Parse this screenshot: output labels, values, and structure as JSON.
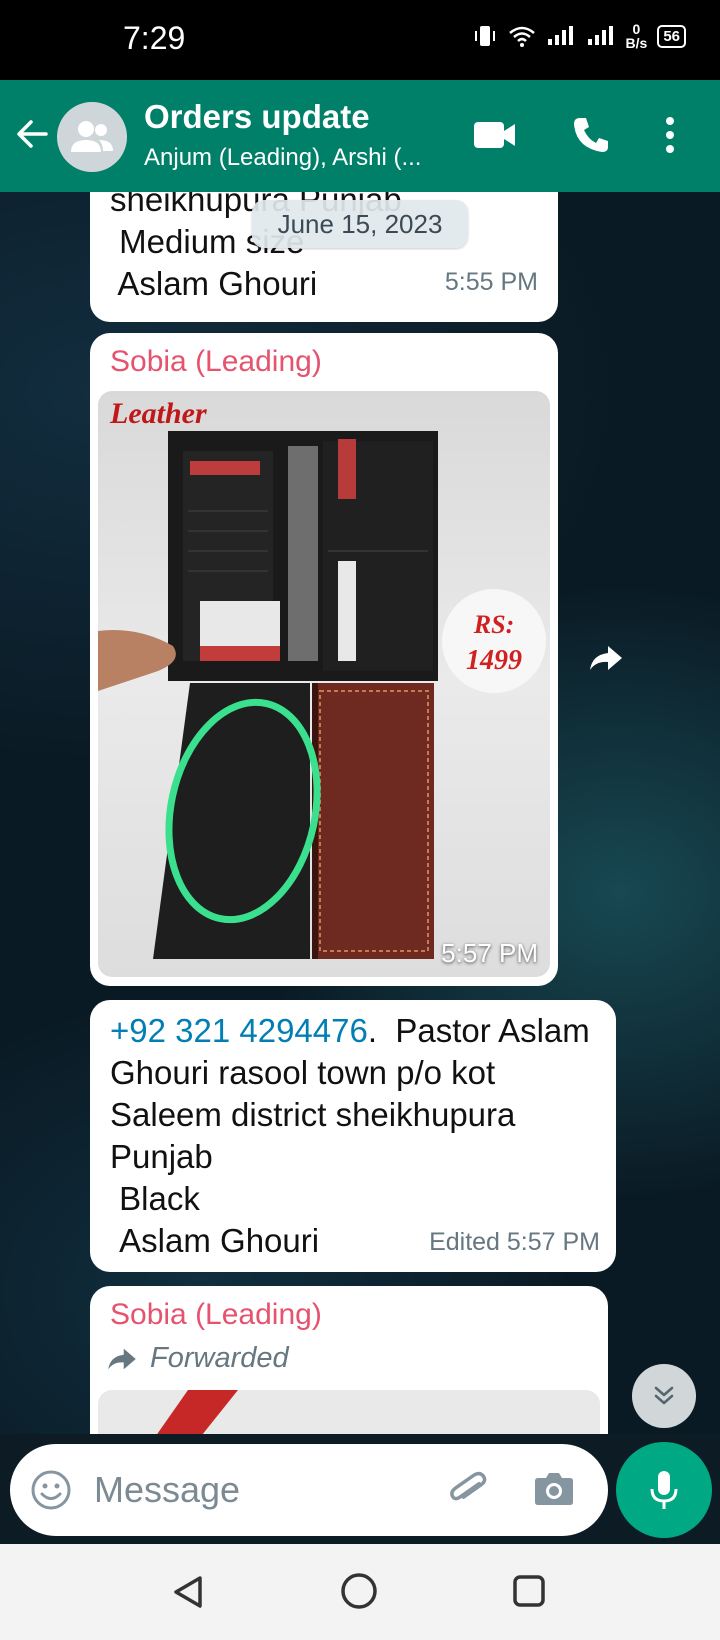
{
  "status_bar": {
    "time": "7:29",
    "net_speed_value": "0",
    "net_speed_unit": "B/s",
    "battery": "56"
  },
  "header": {
    "title": "Orders update",
    "subtitle": "Anjum (Leading), Arshi (..."
  },
  "date_chip": "June 15, 2023",
  "messages": [
    {
      "lines": "sheikhupura Punjab\n Medium size\n Aslam Ghouri",
      "time": "5:55 PM"
    },
    {
      "sender": "Sobia (Leading)",
      "photo": {
        "brand_text": "Leather",
        "price_label": "RS:",
        "price_value": "1499"
      },
      "time": "5:57 PM"
    },
    {
      "phone": "+92 321 4294476",
      "text": ".  Pastor Aslam Ghouri rasool town p/o kot Saleem district sheikhupura Punjab\n Black\n Aslam Ghouri",
      "time": "Edited 5:57 PM"
    },
    {
      "sender": "Sobia (Leading)",
      "forwarded_label": "Forwarded"
    }
  ],
  "input": {
    "placeholder": "Message"
  },
  "colors": {
    "header": "#008069",
    "accent": "#00a884",
    "sender": "#e5536e",
    "link": "#027eb5"
  }
}
